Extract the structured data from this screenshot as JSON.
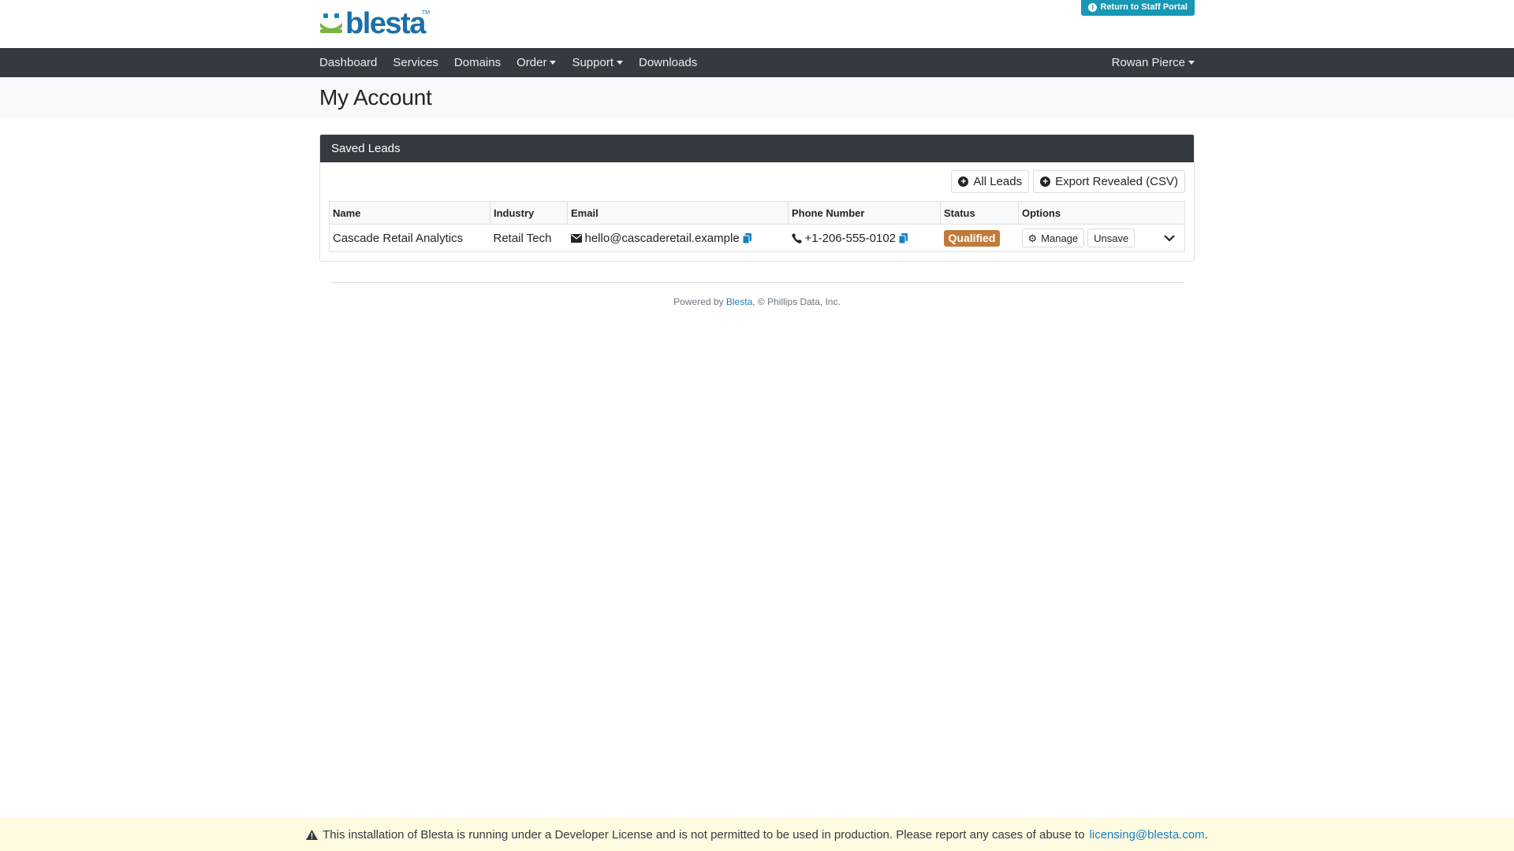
{
  "header": {
    "logo_text": "blesta",
    "staff_portal_label": "Return to Staff Portal"
  },
  "nav": {
    "items": [
      {
        "label": "Dashboard",
        "dropdown": false
      },
      {
        "label": "Services",
        "dropdown": false
      },
      {
        "label": "Domains",
        "dropdown": false
      },
      {
        "label": "Order",
        "dropdown": true
      },
      {
        "label": "Support",
        "dropdown": true
      },
      {
        "label": "Downloads",
        "dropdown": false
      }
    ],
    "user_label": "Rowan Pierce"
  },
  "page": {
    "title": "My Account"
  },
  "card": {
    "title": "Saved Leads",
    "buttons": {
      "all_leads": "All Leads",
      "export": "Export Revealed (CSV)"
    },
    "columns": [
      "Name",
      "Industry",
      "Email",
      "Phone Number",
      "Status",
      "Options"
    ],
    "rows": [
      {
        "name": "Cascade Retail Analytics",
        "industry": "Retail Tech",
        "email": "hello@cascaderetail.example",
        "phone": "+1-206-555-0102",
        "status": "Qualified",
        "manage_label": "Manage",
        "unsave_label": "Unsave"
      }
    ]
  },
  "footer": {
    "powered_prefix": "Powered by",
    "powered_link": "Blesta",
    "powered_suffix": ", © Phillips Data, Inc."
  },
  "dev_notice": {
    "text": "This installation of Blesta is running under a Developer License and is not permitted to be used in production. Please report any cases of abuse to",
    "email": "licensing@blesta.com",
    "end": "."
  },
  "colors": {
    "nav_bg": "#343a40",
    "accent_teal": "#1798b4",
    "badge_qualified": "#c27a3a",
    "link": "#1a7fc1"
  }
}
